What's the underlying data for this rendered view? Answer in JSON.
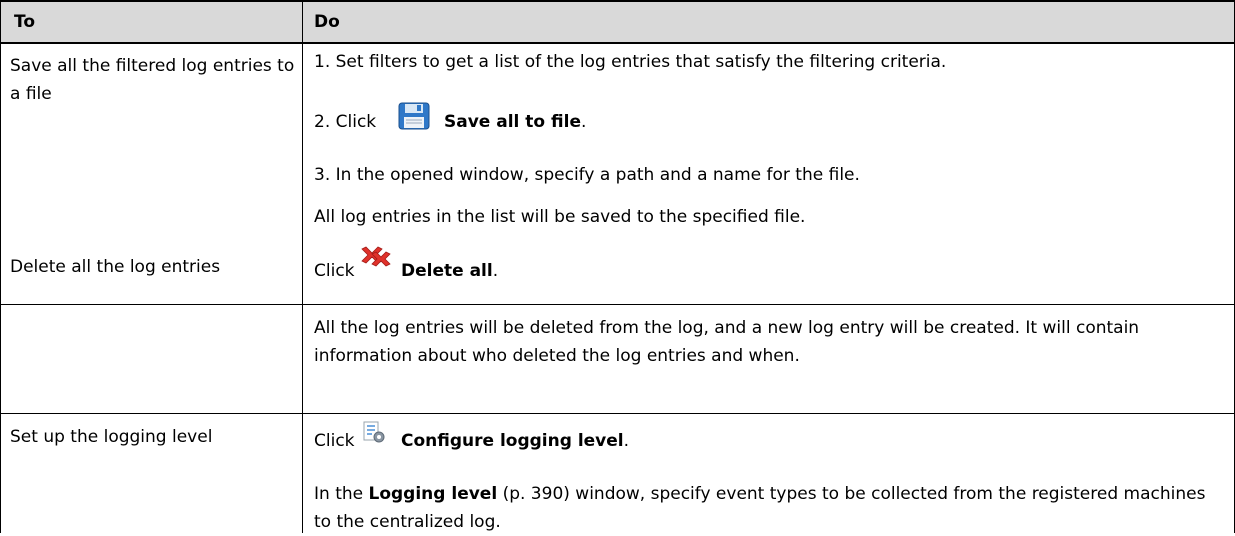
{
  "header": {
    "col_to": "To",
    "col_do": "Do"
  },
  "rows": [
    {
      "to": "Save all the filtered log entries to a file",
      "steps": [
        "1.  Set filters to get a list of the log entries that satisfy the filtering criteria.",
        "2.  Click",
        "3.  In the opened window, specify a path and a name for the file."
      ],
      "step2_action": "Save all to file",
      "step2_suffix": ".",
      "note": "All log entries in the list will be saved to the specified file.",
      "icon": "save-icon"
    },
    {
      "to": "Delete all the log entries",
      "click": "Click",
      "action": "Delete all",
      "suffix": ".",
      "note": "All the log entries will be deleted from the log, and a new log entry will be created. It will contain information about who deleted the log entries and when.",
      "icon": "delete-all-icon"
    },
    {
      "to": "Set up the logging level",
      "click": "Click",
      "action": "Configure logging level",
      "suffix": ".",
      "note_prefix": "In the ",
      "note_bold": "Logging level",
      "note_suffix": " (p. 390) window, specify event types to be collected from the registered machines to the centralized log.",
      "icon": "configure-logging-icon"
    }
  ],
  "colors": {
    "header_bg": "#d9d9d9",
    "border": "#000000"
  }
}
